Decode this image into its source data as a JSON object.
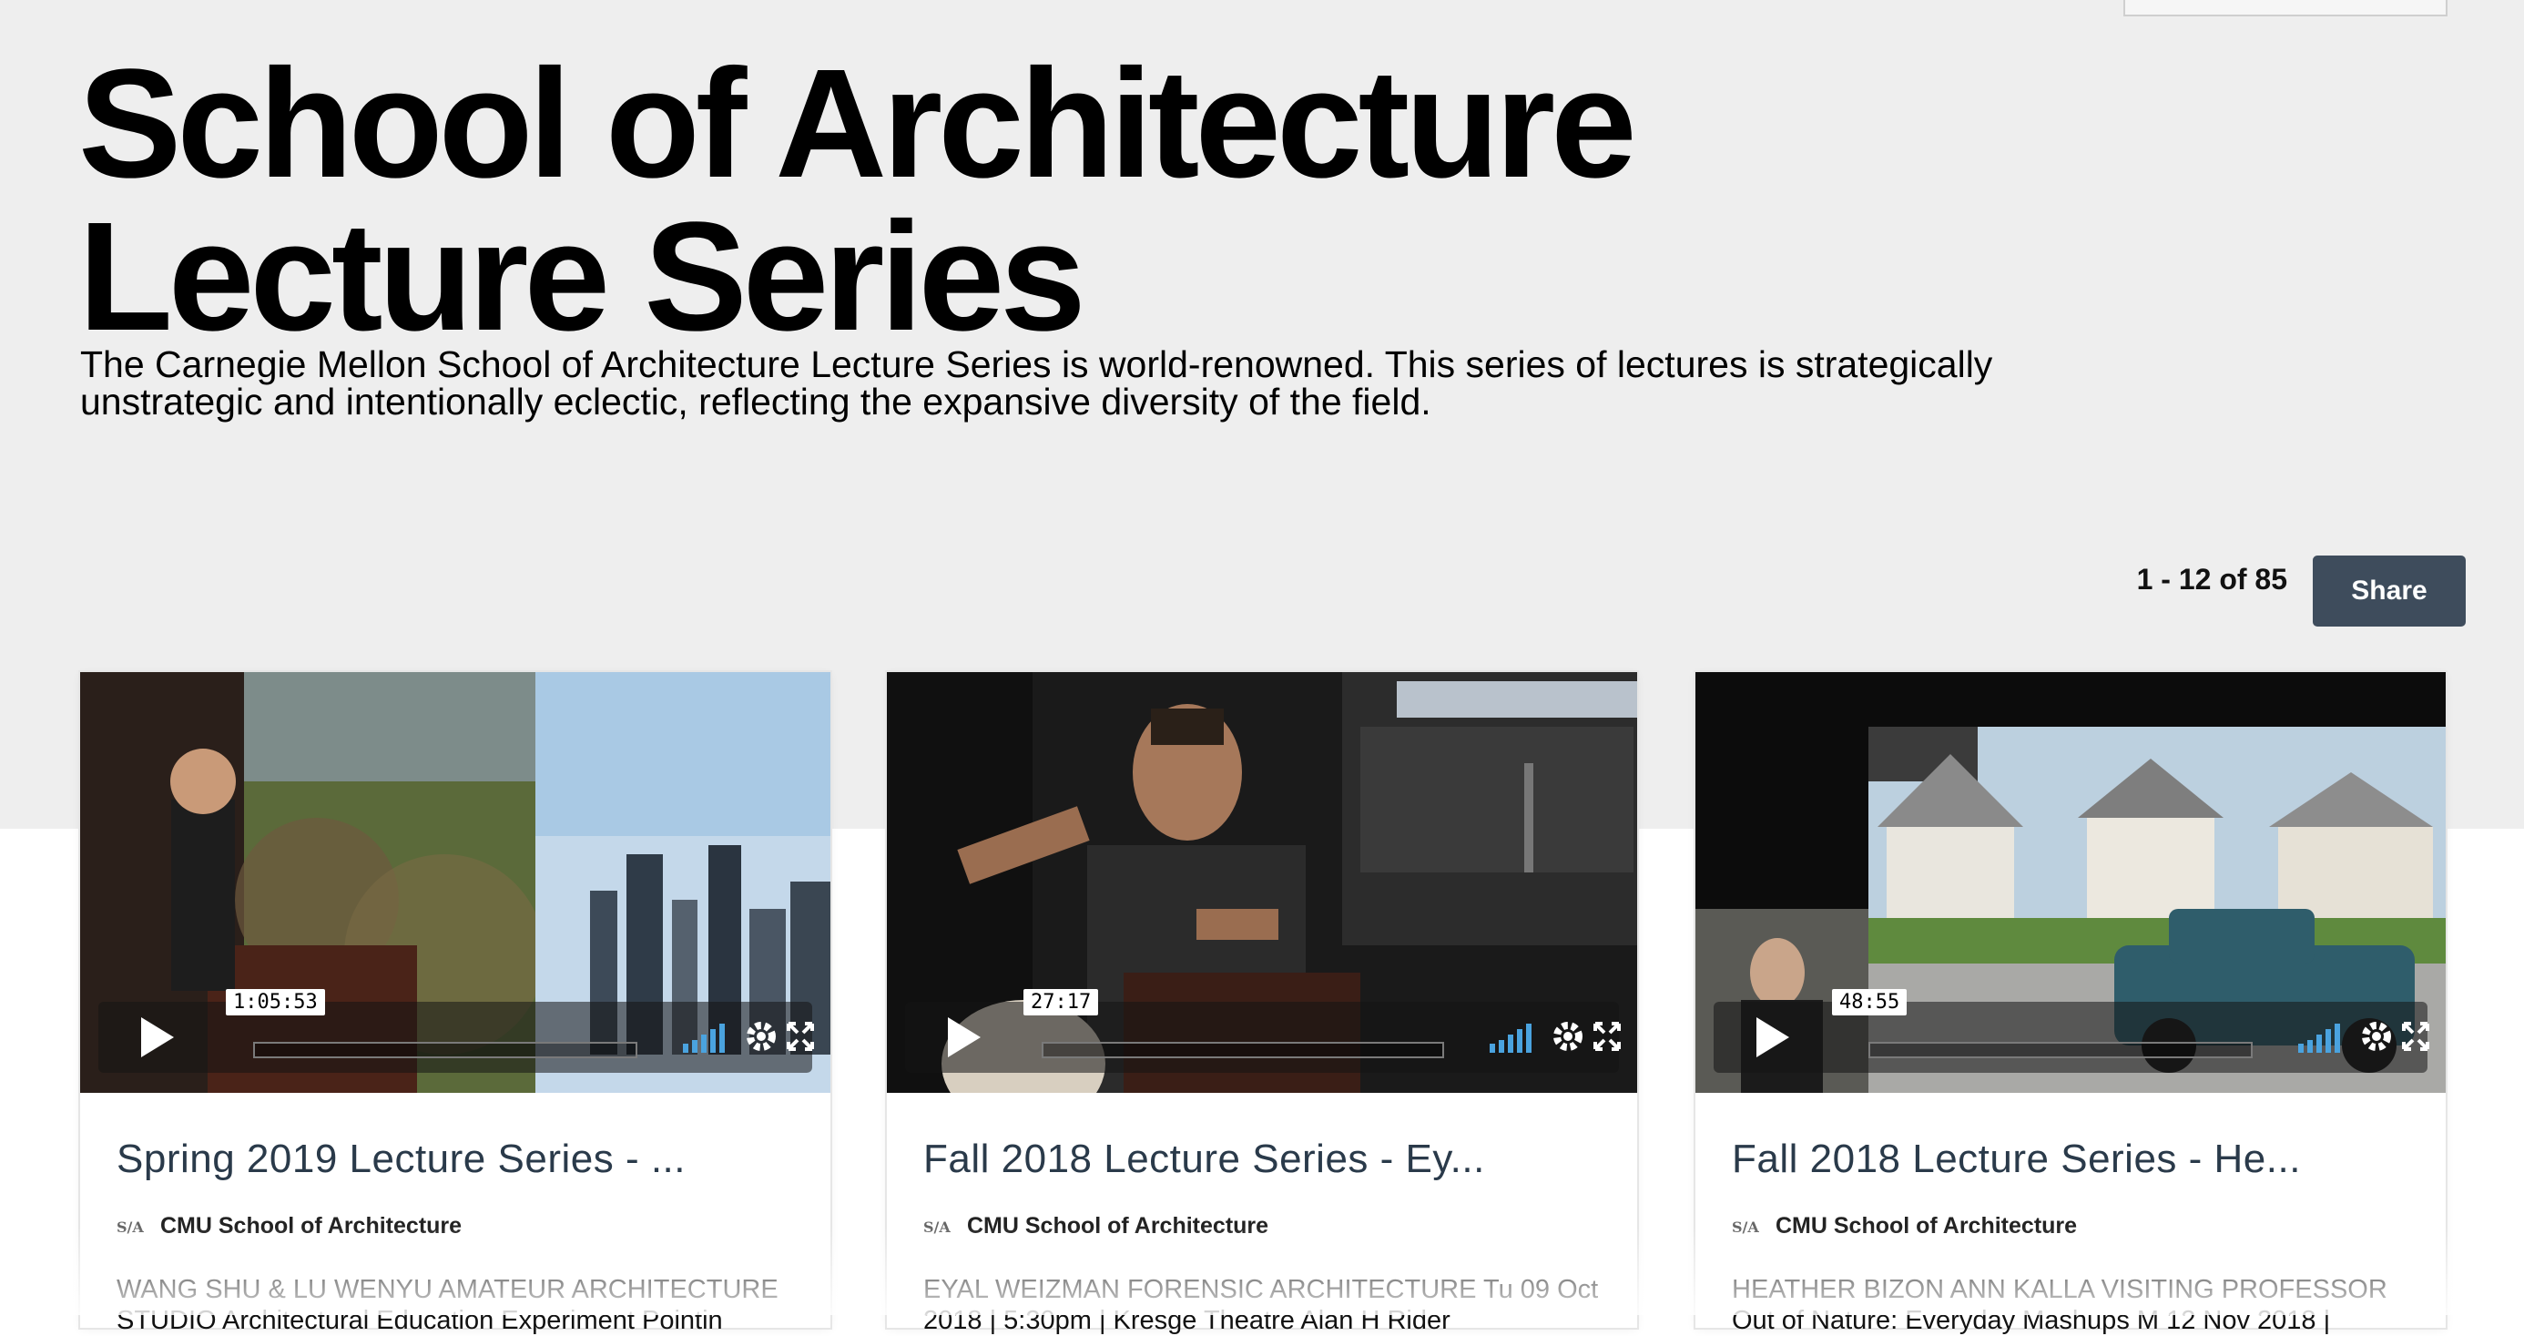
{
  "header": {
    "title_line1": "School of Architecture",
    "title_line2": "Lecture Series",
    "description": "The Carnegie Mellon School of Architecture Lecture Series is world-renowned. This series of lectures is strategically unstrategic and intentionally eclectic, reflecting the expansive diversity of the field.",
    "search_placeholder": ""
  },
  "toolbar": {
    "count": "1 - 12 of 85",
    "share_label": "Share"
  },
  "videos": [
    {
      "title": "Spring 2019 Lecture Series - ...",
      "duration": "1:05:53",
      "channel": "CMU School of Architecture",
      "description": "WANG SHU & LU WENYU AMATEUR ARCHITECTURE STUDIO Architectural Education Experiment Pointin"
    },
    {
      "title": "Fall 2018 Lecture Series - Ey...",
      "duration": "27:17",
      "channel": "CMU School of Architecture",
      "description": "EYAL WEIZMAN FORENSIC ARCHITECTURE Tu 09 Oct 2018 | 5:30pm | Kresge Theatre Alan H Rider"
    },
    {
      "title": "Fall 2018 Lecture Series - He...",
      "duration": "48:55",
      "channel": "CMU School of Architecture",
      "description": "HEATHER BIZON ANN KALLA VISITING PROFESSOR Out of Nature: Everyday Mashups M 12 Nov 2018 |"
    }
  ],
  "colors": {
    "hero_bg": "#eeeeee",
    "share_bg": "#3e4c5c",
    "title_text": "#2a3a4a",
    "volume_bars": "#4aa3df"
  }
}
